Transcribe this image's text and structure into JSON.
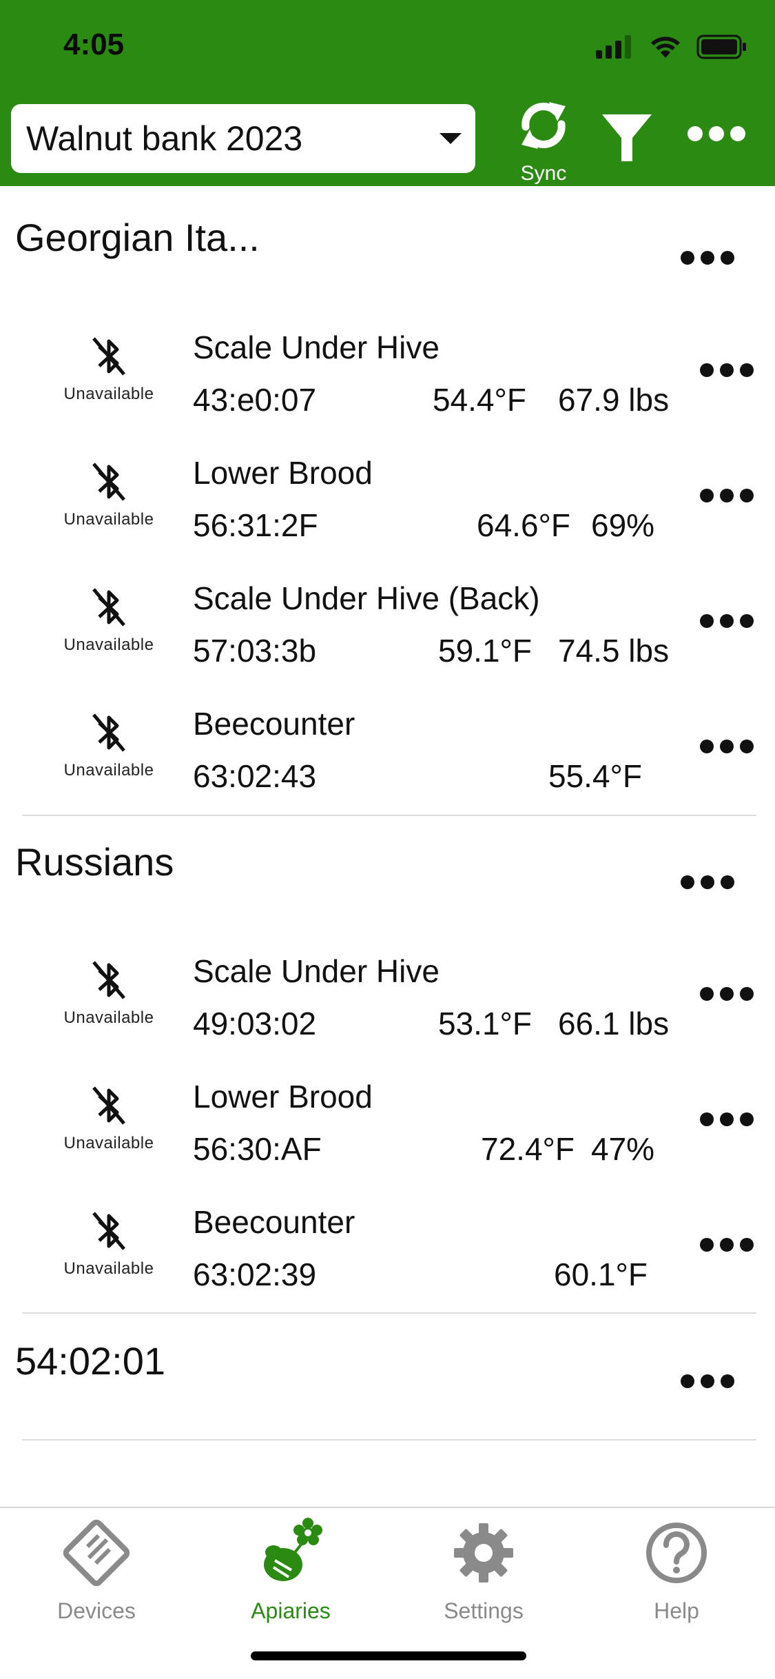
{
  "status_bar": {
    "time": "4:05"
  },
  "header": {
    "apiary_select": "Walnut bank 2023",
    "sync_label": "Sync",
    "colors": {
      "brand": "#2b8a12",
      "header_bg": "#2b8a12"
    }
  },
  "apiaries": [
    {
      "title": "Georgian Ita...",
      "devices": [
        {
          "status": "Unavailable",
          "name": "Scale Under Hive",
          "id": "43:e0:07",
          "temp": "54.4°F",
          "extra": "67.9 lbs"
        },
        {
          "status": "Unavailable",
          "name": "Lower Brood",
          "id": "56:31:2F",
          "temp": "64.6°F",
          "extra": "69%"
        },
        {
          "status": "Unavailable",
          "name": "Scale Under Hive (Back)",
          "id": "57:03:3b",
          "temp": "59.1°F",
          "extra": "74.5 lbs"
        },
        {
          "status": "Unavailable",
          "name": "Beecounter",
          "id": "63:02:43",
          "temp": "55.4°F",
          "extra": ""
        }
      ]
    },
    {
      "title": "Russians",
      "devices": [
        {
          "status": "Unavailable",
          "name": "Scale Under Hive",
          "id": "49:03:02",
          "temp": "53.1°F",
          "extra": "66.1 lbs"
        },
        {
          "status": "Unavailable",
          "name": "Lower Brood",
          "id": "56:30:AF",
          "temp": "72.4°F",
          "extra": "47%"
        },
        {
          "status": "Unavailable",
          "name": "Beecounter",
          "id": "63:02:39",
          "temp": "60.1°F",
          "extra": ""
        }
      ]
    },
    {
      "title": "54:02:01",
      "devices": []
    }
  ],
  "tabs": [
    {
      "label": "Devices",
      "icon": "devices-icon",
      "active": false
    },
    {
      "label": "Apiaries",
      "icon": "apiaries-icon",
      "active": true
    },
    {
      "label": "Settings",
      "icon": "gear-icon",
      "active": false
    },
    {
      "label": "Help",
      "icon": "help-icon",
      "active": false
    }
  ]
}
